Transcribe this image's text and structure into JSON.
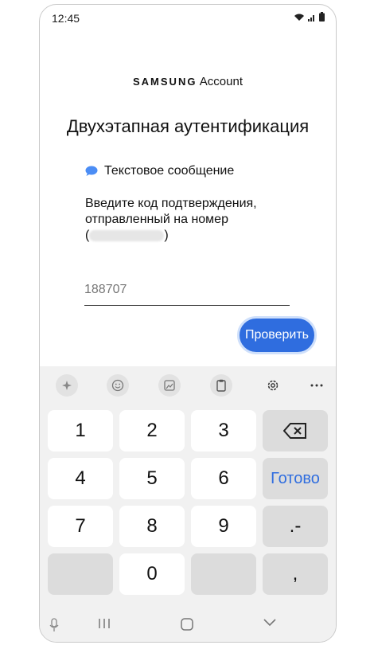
{
  "status_bar": {
    "time": "12:45"
  },
  "header": {
    "brand_samsung": "SAMSUNG",
    "brand_account": "Account",
    "title": "Двухэтапная аутентификация"
  },
  "method": {
    "label": "Текстовое сообщение"
  },
  "description": {
    "line1": "Введите код подтверждения,",
    "line2": "отправленный на номер",
    "open_paren": "(",
    "close_paren": ")"
  },
  "code_input": {
    "value": "188707"
  },
  "verify_button": {
    "label": "Проверить"
  },
  "keyboard": {
    "keys": [
      "1",
      "2",
      "3",
      "4",
      "5",
      "6",
      "7",
      "8",
      "9",
      "0"
    ],
    "done_label": "Готово",
    "dot_dash": ".-",
    "comma": ","
  },
  "colors": {
    "accent": "#2f6ddf"
  }
}
